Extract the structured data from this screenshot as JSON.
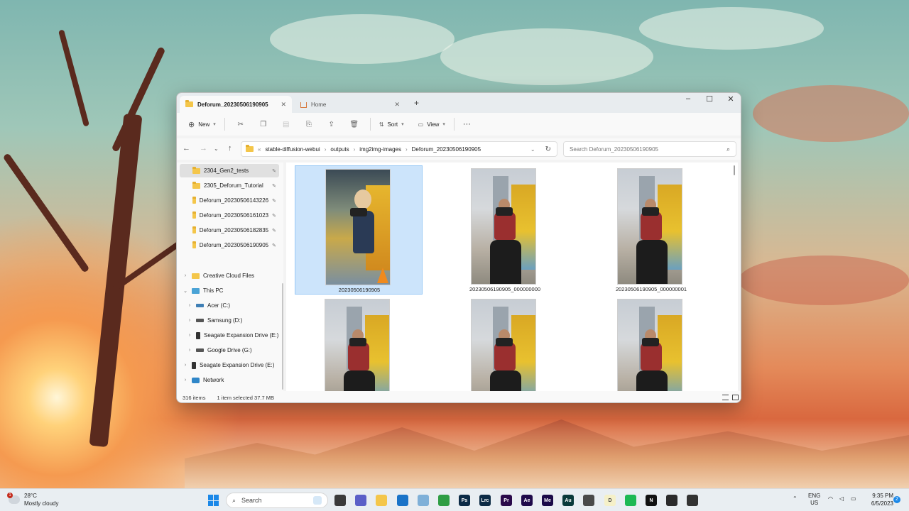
{
  "window": {
    "tabs": [
      {
        "label": "Deforum_20230506190905",
        "active": true
      },
      {
        "label": "Home",
        "active": false
      }
    ],
    "new_tab": "+",
    "controls": {
      "minimize": "–",
      "maximize": "☐",
      "close": "✕"
    }
  },
  "toolbar": {
    "new_label": "New",
    "sort_label": "Sort",
    "view_label": "View",
    "more_label": "···"
  },
  "address": {
    "crumbs": [
      "stable-diffusion-webui",
      "outputs",
      "img2img-images",
      "Deforum_20230506190905"
    ],
    "overflow": "«",
    "search_placeholder": "Search Deforum_20230506190905"
  },
  "sidebar": {
    "quick_access": [
      {
        "label": "2304_Gen2_tests",
        "selected": true
      },
      {
        "label": "2305_Deforum_Tutorial"
      },
      {
        "label": "Deforum_20230506143226"
      },
      {
        "label": "Deforum_20230506161023"
      },
      {
        "label": "Deforum_20230506182835"
      },
      {
        "label": "Deforum_20230506190905"
      }
    ],
    "tree": {
      "creative_cloud": "Creative Cloud Files",
      "this_pc": "This PC",
      "drives": [
        "Acer (C:)",
        "Samsung (D:)",
        "Seagate Expansion Drive (E:)",
        "Google Drive (G:)"
      ],
      "seagate": "Seagate Expansion Drive (E:)",
      "network": "Network"
    }
  },
  "files": [
    {
      "name": "20230506190905",
      "selected": true
    },
    {
      "name": "20230506190905_000000000"
    },
    {
      "name": "20230506190905_000000001"
    },
    {
      "name": ""
    },
    {
      "name": ""
    },
    {
      "name": ""
    }
  ],
  "status": {
    "count": "316 items",
    "selection": "1 item selected  37.7 MB"
  },
  "taskbar": {
    "weather_temp": "28°C",
    "weather_desc": "Mostly cloudy",
    "weather_badge": "1",
    "search_label": "Search",
    "lang_1": "ENG",
    "lang_2": "US",
    "time": "9:35 PM",
    "date": "6/5/2023",
    "notif": "2",
    "apps": [
      {
        "name": "file-manager",
        "label": "",
        "color": "#3a3a3a"
      },
      {
        "name": "teams",
        "label": "",
        "color": "#5b5fc7"
      },
      {
        "name": "explorer",
        "label": "",
        "color": "#f4c64a"
      },
      {
        "name": "mail",
        "label": "",
        "color": "#1a73c8"
      },
      {
        "name": "photos",
        "label": "",
        "color": "#7fb0d8"
      },
      {
        "name": "chrome",
        "label": "",
        "color": "#2f9e44"
      },
      {
        "name": "photoshop",
        "label": "Ps",
        "color": "#0b2a46"
      },
      {
        "name": "lightroom",
        "label": "Lrc",
        "color": "#0d2b45"
      },
      {
        "name": "premiere",
        "label": "Pr",
        "color": "#2a0a4a"
      },
      {
        "name": "after-effects",
        "label": "Ae",
        "color": "#1f0a4a"
      },
      {
        "name": "media-encoder",
        "label": "Me",
        "color": "#1a0a48"
      },
      {
        "name": "audition",
        "label": "Au",
        "color": "#0a3a3a"
      },
      {
        "name": "app-blank",
        "label": "",
        "color": "#4a4a4a"
      },
      {
        "name": "notes",
        "label": "D",
        "color": "#f5f0c8"
      },
      {
        "name": "spotify",
        "label": "",
        "color": "#1db954"
      },
      {
        "name": "notion",
        "label": "N",
        "color": "#111111"
      },
      {
        "name": "terminal",
        "label": "",
        "color": "#2b2b2b"
      },
      {
        "name": "davinci",
        "label": "",
        "color": "#333333"
      }
    ]
  }
}
